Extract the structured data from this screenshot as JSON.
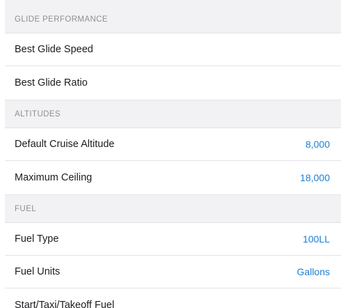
{
  "sections": {
    "glide": {
      "header": "GLIDE PERFORMANCE",
      "rows": [
        {
          "label": "Best Glide Speed",
          "value": ""
        },
        {
          "label": "Best Glide Ratio",
          "value": ""
        }
      ]
    },
    "altitudes": {
      "header": "ALTITUDES",
      "rows": [
        {
          "label": "Default Cruise Altitude",
          "value": "8,000"
        },
        {
          "label": "Maximum Ceiling",
          "value": "18,000"
        }
      ]
    },
    "fuel": {
      "header": "FUEL",
      "rows": [
        {
          "label": "Fuel Type",
          "value": "100LL"
        },
        {
          "label": "Fuel Units",
          "value": "Gallons"
        },
        {
          "label": "Start/Taxi/Takeoff Fuel",
          "value": ""
        }
      ]
    }
  },
  "colors": {
    "accent": "#1a7ed6",
    "section_bg": "#f2f2f4",
    "section_text": "#8e8e93"
  }
}
